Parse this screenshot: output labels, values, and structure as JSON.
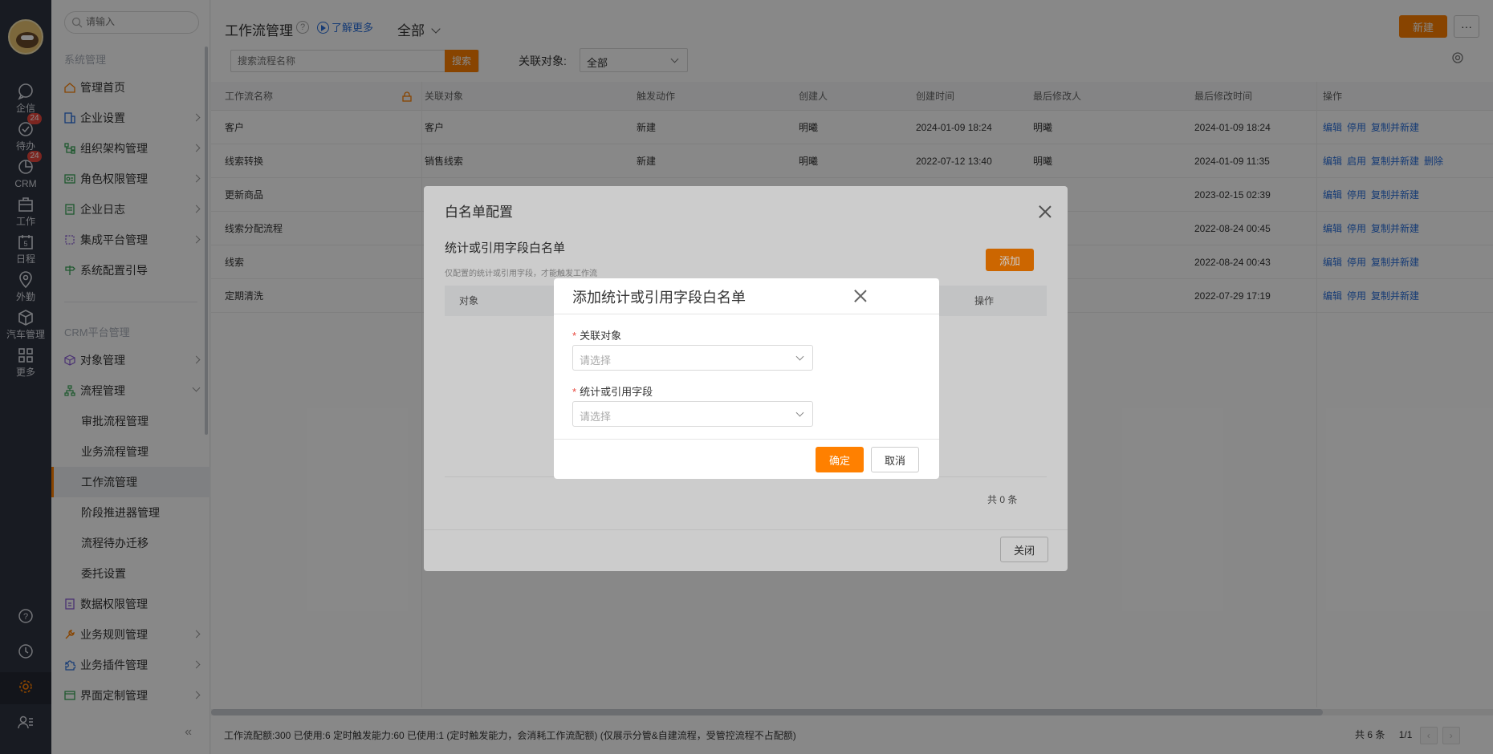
{
  "rail": {
    "items": [
      {
        "label": "企信"
      },
      {
        "label": "待办",
        "badge": "24"
      },
      {
        "label": "CRM",
        "badge": "24"
      },
      {
        "label": "工作"
      },
      {
        "label": "日程",
        "day": "5"
      },
      {
        "label": "外勤"
      },
      {
        "label": "汽车管理"
      },
      {
        "label": "更多"
      }
    ]
  },
  "sidebar": {
    "search_placeholder": "请输入",
    "section1": "系统管理",
    "section2": "CRM平台管理",
    "items1": [
      "管理首页",
      "企业设置",
      "组织架构管理",
      "角色权限管理",
      "企业日志",
      "集成平台管理",
      "系统配置引导"
    ],
    "items2": [
      "对象管理",
      "流程管理"
    ],
    "process_sub": [
      "审批流程管理",
      "业务流程管理",
      "工作流管理",
      "阶段推进器管理",
      "流程待办迁移",
      "委托设置"
    ],
    "items3": [
      "数据权限管理",
      "业务规则管理",
      "业务插件管理",
      "界面定制管理"
    ],
    "collapse": "«"
  },
  "header": {
    "title": "工作流管理",
    "help": "?",
    "learn_more": "了解更多",
    "scope": "全部",
    "new_label": "新建",
    "more_label": "···"
  },
  "filter": {
    "search_placeholder": "搜索流程名称",
    "search_btn": "搜索",
    "rel_label": "关联对象:",
    "rel_value": "全部"
  },
  "table": {
    "headers": [
      "工作流名称",
      "关联对象",
      "触发动作",
      "创建人",
      "创建时间",
      "最后修改人",
      "最后修改时间",
      "操作"
    ],
    "rows": [
      {
        "name": "客户",
        "obj": "客户",
        "action": "新建",
        "creator": "明曦",
        "ctime": "2024-01-09 18:24",
        "modifier": "明曦",
        "mtime": "2024-01-09 18:24",
        "ops": [
          "编辑",
          "停用",
          "复制并新建"
        ]
      },
      {
        "name": "线索转换",
        "obj": "销售线索",
        "action": "新建",
        "creator": "明曦",
        "ctime": "2022-07-12 13:40",
        "modifier": "明曦",
        "mtime": "2024-01-09 11:35",
        "ops": [
          "编辑",
          "启用",
          "复制并新建",
          "删除"
        ]
      },
      {
        "name": "更新商品",
        "obj": "",
        "action": "",
        "creator": "",
        "ctime": "",
        "modifier": "",
        "mtime": "2023-02-15 02:39",
        "ops": [
          "编辑",
          "停用",
          "复制并新建"
        ]
      },
      {
        "name": "线索分配流程",
        "obj": "",
        "action": "",
        "creator": "",
        "ctime": "",
        "modifier": "",
        "mtime": "2022-08-24 00:45",
        "ops": [
          "编辑",
          "停用",
          "复制并新建"
        ]
      },
      {
        "name": "线索",
        "obj": "",
        "action": "",
        "creator": "",
        "ctime": "",
        "modifier": "",
        "mtime": "2022-08-24 00:43",
        "ops": [
          "编辑",
          "停用",
          "复制并新建"
        ]
      },
      {
        "name": "定期清洗",
        "obj": "",
        "action": "",
        "creator": "",
        "ctime": "",
        "modifier": "",
        "mtime": "2022-07-29 17:19",
        "ops": [
          "编辑",
          "停用",
          "复制并新建"
        ]
      }
    ]
  },
  "footer": {
    "quota": "工作流配额:300  已使用:6  定时触发能力:60  已使用:1  (定时触发能力，会消耗工作流配额)   (仅展示分管&自建流程，受管控流程不占配额)",
    "total": "共 6 条",
    "page": "1/1"
  },
  "whitelist": {
    "title": "白名单配置",
    "subtitle": "统计或引用字段白名单",
    "note": "仅配置的统计或引用字段，才能触发工作流",
    "add": "添加",
    "col_obj": "对象",
    "col_op": "操作",
    "total": "共 0 条",
    "close": "关闭"
  },
  "add_dialog": {
    "title": "添加统计或引用字段白名单",
    "field1_label": "关联对象",
    "field1_placeholder": "请选择",
    "field2_label": "统计或引用字段",
    "field2_placeholder": "请选择",
    "ok": "确定",
    "cancel": "取消"
  }
}
